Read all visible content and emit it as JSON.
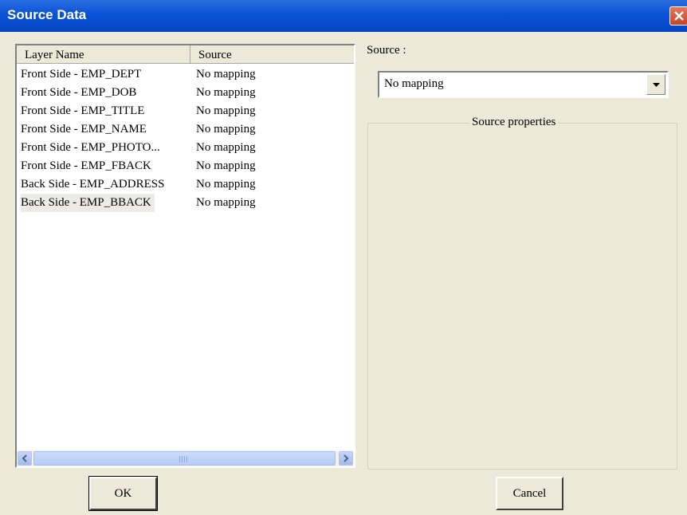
{
  "window": {
    "title": "Source Data"
  },
  "listview": {
    "columns": [
      "Layer Name",
      "Source"
    ],
    "rows": [
      {
        "layer": "Front Side - EMP_DEPT",
        "source": "No mapping"
      },
      {
        "layer": "Front Side - EMP_DOB",
        "source": "No mapping"
      },
      {
        "layer": "Front Side - EMP_TITLE",
        "source": "No mapping"
      },
      {
        "layer": "Front Side - EMP_NAME",
        "source": "No mapping"
      },
      {
        "layer": "Front Side - EMP_PHOTO...",
        "source": "No mapping"
      },
      {
        "layer": "Front Side - EMP_FBACK",
        "source": "No mapping"
      },
      {
        "layer": "Back Side - EMP_ADDRESS",
        "source": "No mapping"
      },
      {
        "layer": "Back Side - EMP_BBACK",
        "source": "No mapping"
      }
    ],
    "selected_index": 7
  },
  "source_panel": {
    "label": "Source :",
    "selected": "No mapping",
    "group_title": "Source properties"
  },
  "buttons": {
    "ok": "OK",
    "cancel": "Cancel"
  },
  "colors": {
    "titlebar": "#0a52d6",
    "dialog": "#ece9d8",
    "close": "#d9532f"
  }
}
